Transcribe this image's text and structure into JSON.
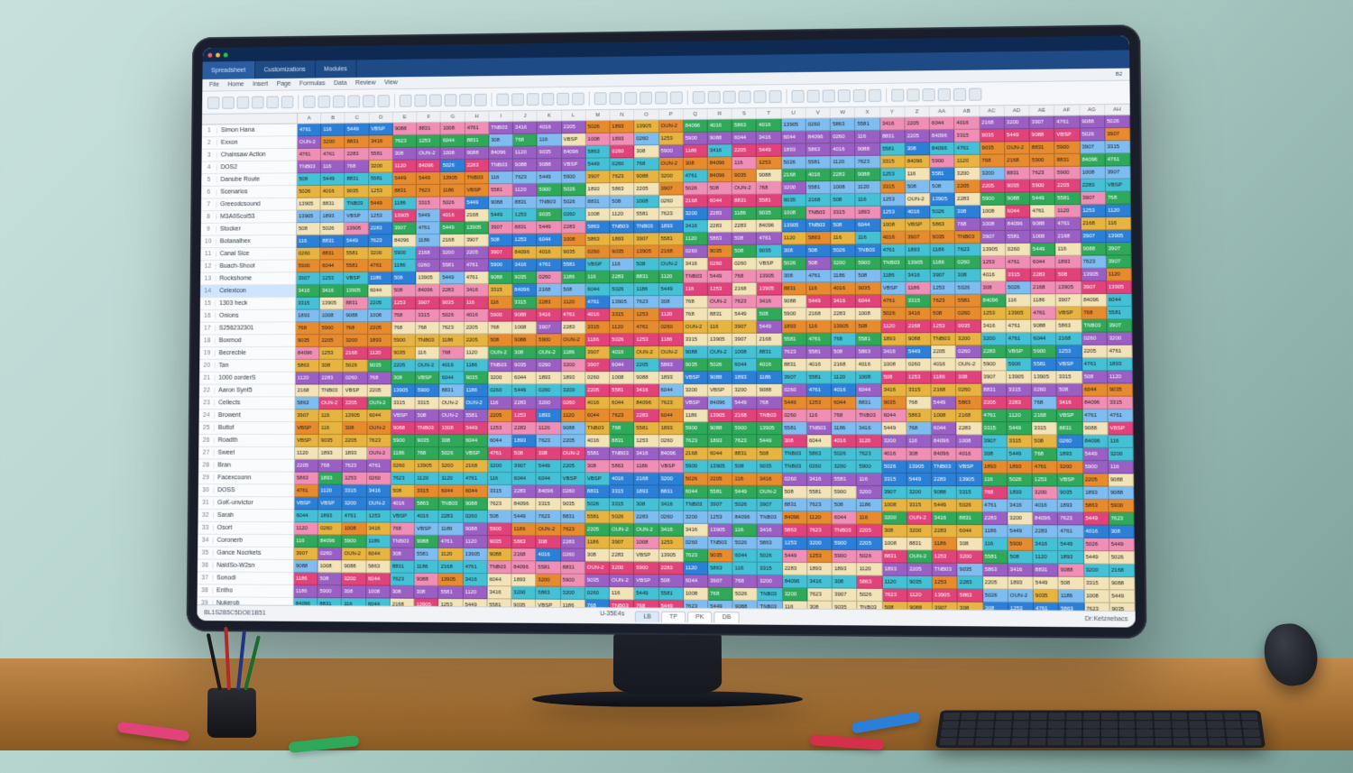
{
  "window": {
    "tabs": [
      "Spreadsheet",
      "Customizations",
      "Modules"
    ],
    "active_tab": 0
  },
  "menu": [
    "File",
    "Home",
    "Insert",
    "Page",
    "Formulas",
    "Data",
    "Review",
    "View"
  ],
  "cell_ref": "B2",
  "status": {
    "left": "BL1S2B5C5DOE1B51",
    "center": "U-35E4s",
    "right": "Dr:Ketznebacs"
  },
  "sheet_tabs": [
    "LB",
    "TP",
    "PK",
    "DB"
  ],
  "active_sheet": 0,
  "num_cols": 34,
  "col_letters": [
    "A",
    "B",
    "C",
    "D",
    "E",
    "F",
    "G",
    "H",
    "I",
    "J",
    "K",
    "L",
    "M",
    "N",
    "O",
    "P",
    "Q",
    "R",
    "S",
    "T",
    "U",
    "V",
    "W",
    "X",
    "Y",
    "Z",
    "AA",
    "AB",
    "AC",
    "AD",
    "AE",
    "AF",
    "AG",
    "AH"
  ],
  "rows": [
    {
      "n": 1,
      "label": "Simon Hana",
      "sel": false
    },
    {
      "n": 2,
      "label": "Exxon",
      "sel": false
    },
    {
      "n": 3,
      "label": "Chainsaw Action",
      "sel": false
    },
    {
      "n": 4,
      "label": "DOS2",
      "sel": false
    },
    {
      "n": 5,
      "label": "Danube Route",
      "sel": false
    },
    {
      "n": 6,
      "label": "Scenarios",
      "sel": false
    },
    {
      "n": 7,
      "label": "Greeodcsound",
      "sel": false
    },
    {
      "n": 8,
      "label": "M3A0Scol53",
      "sel": false
    },
    {
      "n": 9,
      "label": "Stocker",
      "sel": false
    },
    {
      "n": 10,
      "label": "Botanalhex",
      "sel": false
    },
    {
      "n": 11,
      "label": "Canal Sice",
      "sel": false
    },
    {
      "n": 12,
      "label": "Buach-Shoot",
      "sel": false
    },
    {
      "n": 13,
      "label": "Rockshome",
      "sel": false
    },
    {
      "n": 14,
      "label": "Celexicon",
      "sel": true
    },
    {
      "n": 15,
      "label": "1303 heck",
      "sel": false
    },
    {
      "n": 16,
      "label": "Onions",
      "sel": false
    },
    {
      "n": 17,
      "label": "S256232301",
      "sel": false
    },
    {
      "n": 18,
      "label": "Boxmod",
      "sel": false
    },
    {
      "n": 19,
      "label": "Becrecble",
      "sel": false
    },
    {
      "n": 20,
      "label": "Tan",
      "sel": false
    },
    {
      "n": 21,
      "label": "1000 oorderS",
      "sel": false
    },
    {
      "n": 22,
      "label": "Aaron Synt5",
      "sel": false
    },
    {
      "n": 23,
      "label": "Cellects",
      "sel": false
    },
    {
      "n": 24,
      "label": "Browent",
      "sel": false
    },
    {
      "n": 25,
      "label": "Buttof",
      "sel": false
    },
    {
      "n": 26,
      "label": "Roadth",
      "sel": false
    },
    {
      "n": 27,
      "label": "Sweet",
      "sel": false
    },
    {
      "n": 28,
      "label": "Bran",
      "sel": false
    },
    {
      "n": 29,
      "label": "Facexcoonn",
      "sel": false
    },
    {
      "n": 30,
      "label": "DOSS",
      "sel": false
    },
    {
      "n": 31,
      "label": "GoK-unvictor",
      "sel": false
    },
    {
      "n": 32,
      "label": "Sarah",
      "sel": false
    },
    {
      "n": 33,
      "label": "Osort",
      "sel": false
    },
    {
      "n": 34,
      "label": "Coronerb",
      "sel": false
    },
    {
      "n": 35,
      "label": "Gance Nocrkets",
      "sel": false
    },
    {
      "n": 36,
      "label": "NaldSo-W2sn",
      "sel": false
    },
    {
      "n": 37,
      "label": "Sonodi",
      "sel": false
    },
    {
      "n": 38,
      "label": "Entho",
      "sel": false
    },
    {
      "n": 39,
      "label": "Nukerob",
      "sel": false
    }
  ],
  "colors": {
    "magenta": "#e0427a",
    "blue": "#2c7fd6",
    "green": "#2fa85a",
    "yellow": "#e7b441",
    "orange": "#e78b2f",
    "purple": "#9a5fc2",
    "cyan": "#45c1d6",
    "pink": "#f08fb5",
    "lightblue": "#7fbdf0",
    "cream": "#f2e4b8"
  },
  "sample_values": [
    "1008",
    "3416",
    "508",
    "9088",
    "3200",
    "1253",
    "4761",
    "5863",
    "2205",
    "1186",
    "768",
    "9035",
    "5449",
    "2283",
    "7623",
    "1893",
    "5026",
    "308",
    "116",
    "4016",
    "8831",
    "3907",
    "2168",
    "5581",
    "6044",
    "1120",
    "84096",
    "3315",
    "TNB03",
    "OUN-2",
    "VBSP",
    "13905",
    "0260",
    "5900"
  ]
}
